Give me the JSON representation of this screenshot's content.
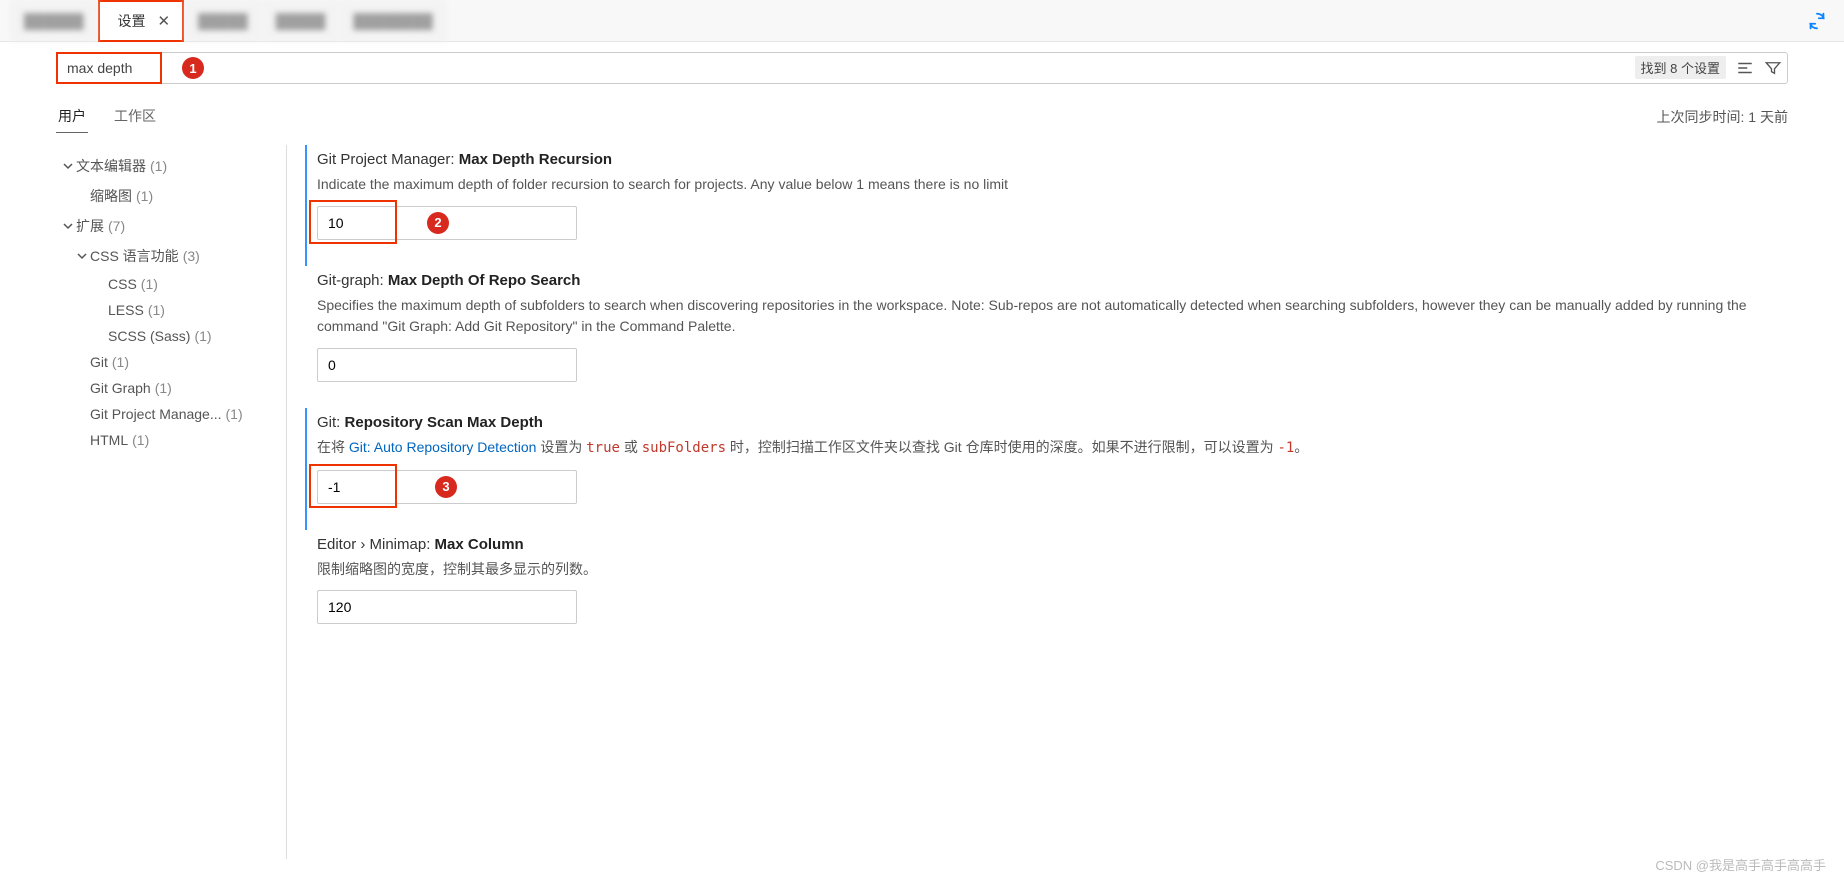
{
  "tabs": {
    "active_label": "设置",
    "close_title": "关闭"
  },
  "search": {
    "value": "max depth",
    "result_count": "找到 8 个设置"
  },
  "scope": {
    "user": "用户",
    "workspace": "工作区",
    "sync_text": "上次同步时间: 1 天前"
  },
  "sidebar": {
    "text_editor": {
      "label": "文本编辑器",
      "count": "(1)"
    },
    "minimap": {
      "label": "缩略图",
      "count": "(1)"
    },
    "extensions": {
      "label": "扩展",
      "count": "(7)"
    },
    "css_lang": {
      "label": "CSS 语言功能",
      "count": "(3)"
    },
    "css": {
      "label": "CSS",
      "count": "(1)"
    },
    "less": {
      "label": "LESS",
      "count": "(1)"
    },
    "scss": {
      "label": "SCSS (Sass)",
      "count": "(1)"
    },
    "git": {
      "label": "Git",
      "count": "(1)"
    },
    "git_graph": {
      "label": "Git Graph",
      "count": "(1)"
    },
    "gpm": {
      "label": "Git Project Manage...",
      "count": "(1)"
    },
    "html": {
      "label": "HTML",
      "count": "(1)"
    }
  },
  "settings": [
    {
      "scope": "Git Project Manager:",
      "name": "Max Depth Recursion",
      "desc": "Indicate the maximum depth of folder recursion to search for projects. Any value below 1 means there is no limit",
      "value": "10",
      "boxed": true,
      "badge": "2",
      "hl": true
    },
    {
      "scope": "Git-graph:",
      "name": "Max Depth Of Repo Search",
      "desc": "Specifies the maximum depth of subfolders to search when discovering repositories in the workspace. Note: Sub-repos are not automatically detected when searching subfolders, however they can be manually added by running the command \"Git Graph: Add Git Repository\" in the Command Palette.",
      "value": "0"
    },
    {
      "scope": "Git:",
      "name": "Repository Scan Max Depth",
      "desc_pre": "在将 ",
      "link": "Git: Auto Repository Detection",
      "desc_mid1": " 设置为 ",
      "code1": "true",
      "desc_mid2": " 或 ",
      "code2": "subFolders",
      "desc_mid3": " 时，控制扫描工作区文件夹以查找 Git 仓库时使用的深度。如果不进行限制，可以设置为 ",
      "code3": "-1",
      "desc_post": "。",
      "value": "-1",
      "boxed": true,
      "badge": "3",
      "hl": true
    },
    {
      "scope": "Editor › Minimap:",
      "name": "Max Column",
      "desc": "限制缩略图的宽度，控制其最多显示的列数。",
      "value": "120",
      "gear": true
    }
  ],
  "badges": {
    "b1": "1",
    "b2": "2",
    "b3": "3"
  },
  "watermark": "CSDN @我是高手高手高高手"
}
